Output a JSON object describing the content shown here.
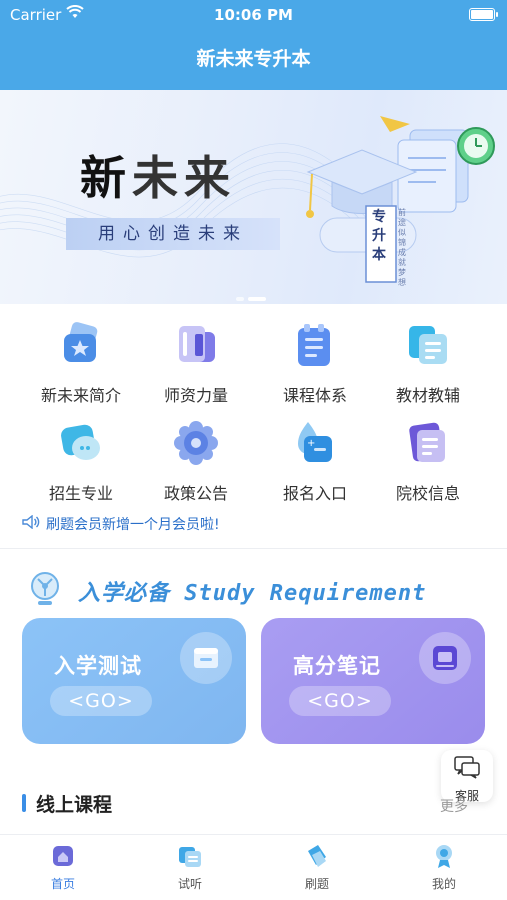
{
  "status_bar": {
    "carrier": "Carrier",
    "time": "10:06 PM"
  },
  "nav": {
    "title": "新未来专升本"
  },
  "banner": {
    "title_a": "新",
    "title_b": "未来",
    "slogan": "用心创造未来",
    "badge": "专升本",
    "side_text": "前途似锦 成就梦想"
  },
  "grid": {
    "items": [
      {
        "label": "新未来简介",
        "icon": "star-card-icon"
      },
      {
        "label": "师资力量",
        "icon": "book-icon"
      },
      {
        "label": "课程体系",
        "icon": "clipboard-icon"
      },
      {
        "label": "教材教辅",
        "icon": "documents-icon"
      },
      {
        "label": "招生专业",
        "icon": "chat-bubble-icon"
      },
      {
        "label": "政策公告",
        "icon": "gear-flower-icon"
      },
      {
        "label": "报名入口",
        "icon": "signup-card-icon"
      },
      {
        "label": "院校信息",
        "icon": "id-card-icon"
      }
    ]
  },
  "notice": {
    "text": "刷题会员新增一个月会员啦!"
  },
  "study": {
    "heading": "入学必备 Study Requirement"
  },
  "cards": {
    "left": {
      "title": "入学测试",
      "go": "<GO>"
    },
    "right": {
      "title": "高分笔记",
      "go": "<GO>"
    }
  },
  "service": {
    "label": "客服"
  },
  "online": {
    "title": "线上课程",
    "more": "更多"
  },
  "tabs": [
    {
      "label": "首页",
      "active": true
    },
    {
      "label": "试听",
      "active": false
    },
    {
      "label": "刷题",
      "active": false
    },
    {
      "label": "我的",
      "active": false
    }
  ],
  "colors": {
    "primary": "#4aa8e8",
    "accent_blue": "#3a8ee6",
    "card_blue": "#8cc3f7",
    "card_purple": "#a99df2"
  }
}
